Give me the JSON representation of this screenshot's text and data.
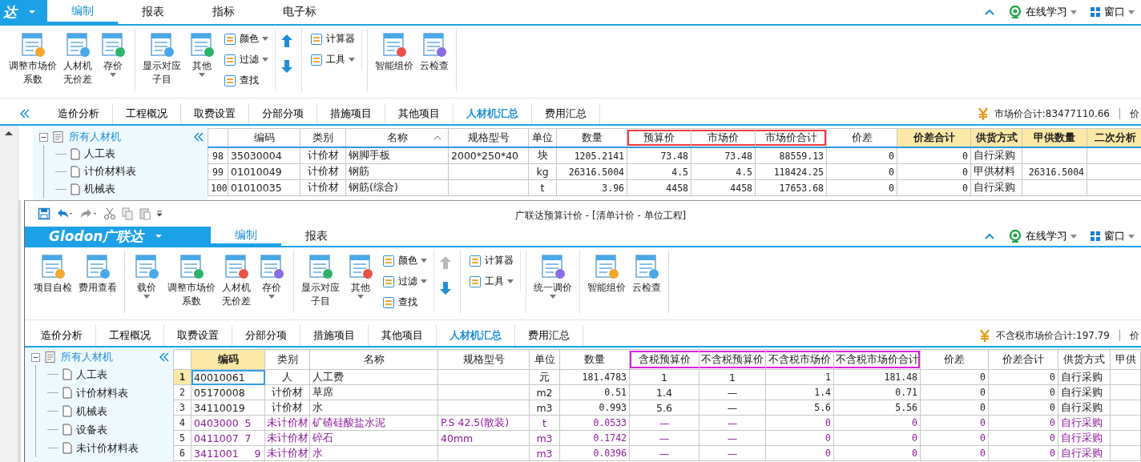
{
  "windows": [
    {
      "logo": "达",
      "collapse_button": true,
      "menu_tabs": [
        {
          "label": "编制",
          "selected": true
        },
        {
          "label": "报表",
          "selected": false
        },
        {
          "label": "指标",
          "selected": false
        },
        {
          "label": "电子标",
          "selected": false
        }
      ],
      "right_links": [
        "在线学习",
        "窗口"
      ],
      "ribbon": [
        {
          "items": [
            {
              "kind": "large",
              "lines": [
                "调整市场价",
                "系数"
              ],
              "menu": false
            },
            {
              "kind": "large",
              "lines": [
                "人材机",
                "无价差"
              ],
              "menu": false
            },
            {
              "kind": "large",
              "lines": [
                "存价"
              ],
              "menu": true
            }
          ]
        },
        {
          "items": [
            {
              "kind": "large",
              "lines": [
                "显示对应",
                "子目"
              ],
              "menu": false
            },
            {
              "kind": "large",
              "lines": [
                "其他"
              ],
              "menu": true
            },
            {
              "kind": "stack",
              "items": [
                {
                  "label": "颜色",
                  "menu": true
                },
                {
                  "label": "过滤",
                  "menu": true
                },
                {
                  "label": "查找",
                  "menu": false
                }
              ]
            },
            {
              "kind": "arrows",
              "up_disabled": false
            }
          ]
        },
        {
          "items": [
            {
              "kind": "stack",
              "items": [
                {
                  "label": "计算器",
                  "menu": false
                },
                {
                  "label": "工具",
                  "menu": true
                }
              ]
            }
          ]
        },
        {
          "items": [
            {
              "kind": "large",
              "lines": [
                "智能组价"
              ],
              "menu": false
            },
            {
              "kind": "large",
              "lines": [
                "云检查"
              ],
              "menu": false
            }
          ]
        }
      ],
      "tabs": [
        {
          "label": "造价分析",
          "selected": false
        },
        {
          "label": "工程概况",
          "selected": false
        },
        {
          "label": "取费设置",
          "selected": false
        },
        {
          "label": "分部分项",
          "selected": false
        },
        {
          "label": "措施项目",
          "selected": false
        },
        {
          "label": "其他项目",
          "selected": false
        },
        {
          "label": "人材机汇总",
          "selected": true
        },
        {
          "label": "费用汇总",
          "selected": false
        }
      ],
      "summary": "市场价合计:83477110.66",
      "summary_next": "价",
      "tree": {
        "label": "所有人材机",
        "expanded": true,
        "children": [
          {
            "label": "人工表"
          },
          {
            "label": "计价材料表"
          },
          {
            "label": "机械表"
          }
        ]
      },
      "table": {
        "columns": [
          {
            "label": "编码",
            "highlighted": false,
            "sorted": false,
            "boxed": false
          },
          {
            "label": "类别",
            "highlighted": false,
            "sorted": false,
            "boxed": false
          },
          {
            "label": "名称",
            "highlighted": false,
            "sorted": true,
            "boxed": false
          },
          {
            "label": "规格型号",
            "highlighted": false,
            "sorted": false,
            "boxed": false
          },
          {
            "label": "单位",
            "highlighted": false,
            "sorted": false,
            "boxed": false
          },
          {
            "label": "数量",
            "highlighted": false,
            "sorted": false,
            "boxed": false
          },
          {
            "label": "预算价",
            "highlighted": false,
            "sorted": false,
            "boxed": true
          },
          {
            "label": "市场价",
            "highlighted": false,
            "sorted": false,
            "boxed": true
          },
          {
            "label": "市场价合计",
            "highlighted": false,
            "sorted": false,
            "boxed": true
          },
          {
            "label": "价差",
            "highlighted": false,
            "sorted": false,
            "boxed": false
          },
          {
            "label": "价差合计",
            "highlighted": true,
            "sorted": false,
            "boxed": false
          },
          {
            "label": "供货方式",
            "highlighted": true,
            "sorted": false,
            "boxed": false
          },
          {
            "label": "甲供数量",
            "highlighted": true,
            "sorted": false,
            "boxed": false
          },
          {
            "label": "二次分析",
            "highlighted": true,
            "sorted": false,
            "boxed": false
          }
        ],
        "rows": [
          {
            "number": "98",
            "selected": false,
            "kind": "priced",
            "cells": [
              "35030004",
              "计价材",
              "钢脚手板",
              "2000*250*40",
              "块",
              "1205.2141",
              "73.48",
              "73.48",
              "88559.13",
              "0",
              "0",
              "自行采购",
              null,
              null
            ]
          },
          {
            "number": "99",
            "selected": false,
            "kind": "priced",
            "cells": [
              "01010049",
              "计价材",
              "钢筋",
              null,
              "kg",
              "26316.5004",
              "4.5",
              "4.5",
              "118424.25",
              "0",
              "0",
              "甲供材料",
              "26316.5004",
              null
            ]
          },
          {
            "number": "100",
            "selected": false,
            "kind": "priced",
            "cells": [
              "01010035",
              "计价材",
              "钢筋(综合)",
              null,
              "t",
              "3.96",
              "4458",
              "4458",
              "17653.68",
              "0",
              "0",
              "自行采购",
              null,
              null
            ]
          }
        ]
      }
    },
    {
      "title": "广联达预算计价 - [清单计价 - 单位工程]",
      "logo": "Glodon广联达",
      "collapse_button": false,
      "menu_tabs": [
        {
          "label": "编制",
          "selected": true
        },
        {
          "label": "报表",
          "selected": false
        }
      ],
      "right_links": [
        "在线学习",
        "窗口"
      ],
      "ribbon": [
        {
          "items": [
            {
              "kind": "large",
              "lines": [
                "项目自检"
              ],
              "menu": false
            },
            {
              "kind": "large",
              "lines": [
                "费用查看"
              ],
              "menu": false
            }
          ]
        },
        {
          "items": [
            {
              "kind": "large",
              "lines": [
                "载价"
              ],
              "menu": true
            },
            {
              "kind": "large",
              "lines": [
                "调整市场价",
                "系数"
              ],
              "menu": false
            },
            {
              "kind": "large",
              "lines": [
                "人材机",
                "无价差"
              ],
              "menu": false
            },
            {
              "kind": "large",
              "lines": [
                "存价"
              ],
              "menu": true
            }
          ]
        },
        {
          "items": [
            {
              "kind": "large",
              "lines": [
                "显示对应",
                "子目"
              ],
              "menu": false
            },
            {
              "kind": "large",
              "lines": [
                "其他"
              ],
              "menu": true
            },
            {
              "kind": "stack",
              "items": [
                {
                  "label": "颜色",
                  "menu": true
                },
                {
                  "label": "过滤",
                  "menu": true
                },
                {
                  "label": "查找",
                  "menu": false
                }
              ]
            },
            {
              "kind": "arrows",
              "up_disabled": true
            }
          ]
        },
        {
          "items": [
            {
              "kind": "stack",
              "items": [
                {
                  "label": "计算器",
                  "menu": false
                },
                {
                  "label": "工具",
                  "menu": true
                }
              ]
            }
          ]
        },
        {
          "items": [
            {
              "kind": "large",
              "lines": [
                "统一调价"
              ],
              "menu": true
            }
          ]
        },
        {
          "items": [
            {
              "kind": "large",
              "lines": [
                "智能组价"
              ],
              "menu": false
            },
            {
              "kind": "large",
              "lines": [
                "云检查"
              ],
              "menu": false
            }
          ]
        }
      ],
      "tabs": [
        {
          "label": "造价分析",
          "selected": false
        },
        {
          "label": "工程概况",
          "selected": false
        },
        {
          "label": "取费设置",
          "selected": false
        },
        {
          "label": "分部分项",
          "selected": false
        },
        {
          "label": "措施项目",
          "selected": false
        },
        {
          "label": "其他项目",
          "selected": false
        },
        {
          "label": "人材机汇总",
          "selected": true
        },
        {
          "label": "费用汇总",
          "selected": false
        }
      ],
      "summary": "不含税市场价合计:197.79",
      "summary_next": "价",
      "tree": {
        "label": "所有人材机",
        "expanded": true,
        "children": [
          {
            "label": "人工表"
          },
          {
            "label": "计价材料表"
          },
          {
            "label": "机械表"
          },
          {
            "label": "设备表"
          },
          {
            "label": "未计价材料表"
          }
        ]
      },
      "table": {
        "columns": [
          {
            "label": "编码",
            "highlighted": true,
            "sorted": false,
            "boxed": false
          },
          {
            "label": "类别",
            "highlighted": false,
            "sorted": false,
            "boxed": false
          },
          {
            "label": "名称",
            "highlighted": false,
            "sorted": false,
            "boxed": false
          },
          {
            "label": "规格型号",
            "highlighted": false,
            "sorted": false,
            "boxed": false
          },
          {
            "label": "单位",
            "highlighted": false,
            "sorted": false,
            "boxed": false
          },
          {
            "label": "数量",
            "highlighted": false,
            "sorted": false,
            "boxed": false
          },
          {
            "label": "含税预算价",
            "highlighted": false,
            "sorted": false,
            "boxed": true
          },
          {
            "label": "不含税预算价",
            "highlighted": false,
            "sorted": false,
            "boxed": true
          },
          {
            "label": "不含税市场价",
            "highlighted": false,
            "sorted": false,
            "boxed": true
          },
          {
            "label": "不含税市场价合计",
            "highlighted": false,
            "sorted": false,
            "boxed": true
          },
          {
            "label": "价差",
            "highlighted": false,
            "sorted": false,
            "boxed": false
          },
          {
            "label": "价差合计",
            "highlighted": false,
            "sorted": false,
            "boxed": false
          },
          {
            "label": "供货方式",
            "highlighted": false,
            "sorted": false,
            "boxed": false
          },
          {
            "label": "甲供",
            "highlighted": false,
            "sorted": false,
            "boxed": false
          }
        ],
        "rows": [
          {
            "number": "1",
            "selected": true,
            "kind": "priced",
            "cells": [
              "40010061",
              "人",
              "人工费",
              null,
              "元",
              "181.4783",
              "1",
              "1",
              "1",
              "181.48",
              "0",
              "0",
              "自行采购",
              null
            ]
          },
          {
            "number": "2",
            "selected": false,
            "kind": "priced",
            "cells": [
              "05170008",
              "计价材",
              "草席",
              null,
              "m2",
              "0.51",
              "1.4",
              "—",
              "1.4",
              "0.71",
              "0",
              "0",
              "自行采购",
              null
            ]
          },
          {
            "number": "3",
            "selected": false,
            "kind": "priced",
            "cells": [
              "34110019",
              "计价材",
              "水",
              null,
              "m3",
              "0.993",
              "5.6",
              "—",
              "5.6",
              "5.56",
              "0",
              "0",
              "自行采购",
              null
            ]
          },
          {
            "number": "4",
            "selected": false,
            "kind": "unpriced",
            "cells": [
              "0403000  5",
              "未计价材",
              "矿碴硅酸盐水泥",
              "P.S 42.5(散装)",
              "t",
              "0.0533",
              "—",
              "—",
              "0",
              "0",
              "0",
              "0",
              "自行采购",
              null
            ]
          },
          {
            "number": "5",
            "selected": false,
            "kind": "unpriced",
            "cells": [
              "0411007  7",
              "未计价材",
              "碎石",
              "40mm",
              "m3",
              "0.1742",
              "—",
              "—",
              "0",
              "0",
              "0",
              "0",
              "自行采购",
              null
            ]
          },
          {
            "number": "6",
            "selected": false,
            "kind": "unpriced",
            "cells": [
              "3411001     9",
              "未计价材",
              "水",
              null,
              "m3",
              "0.0396",
              "—",
              "—",
              "0",
              "0",
              "0",
              "0",
              "自行采购",
              null
            ]
          }
        ]
      }
    }
  ]
}
